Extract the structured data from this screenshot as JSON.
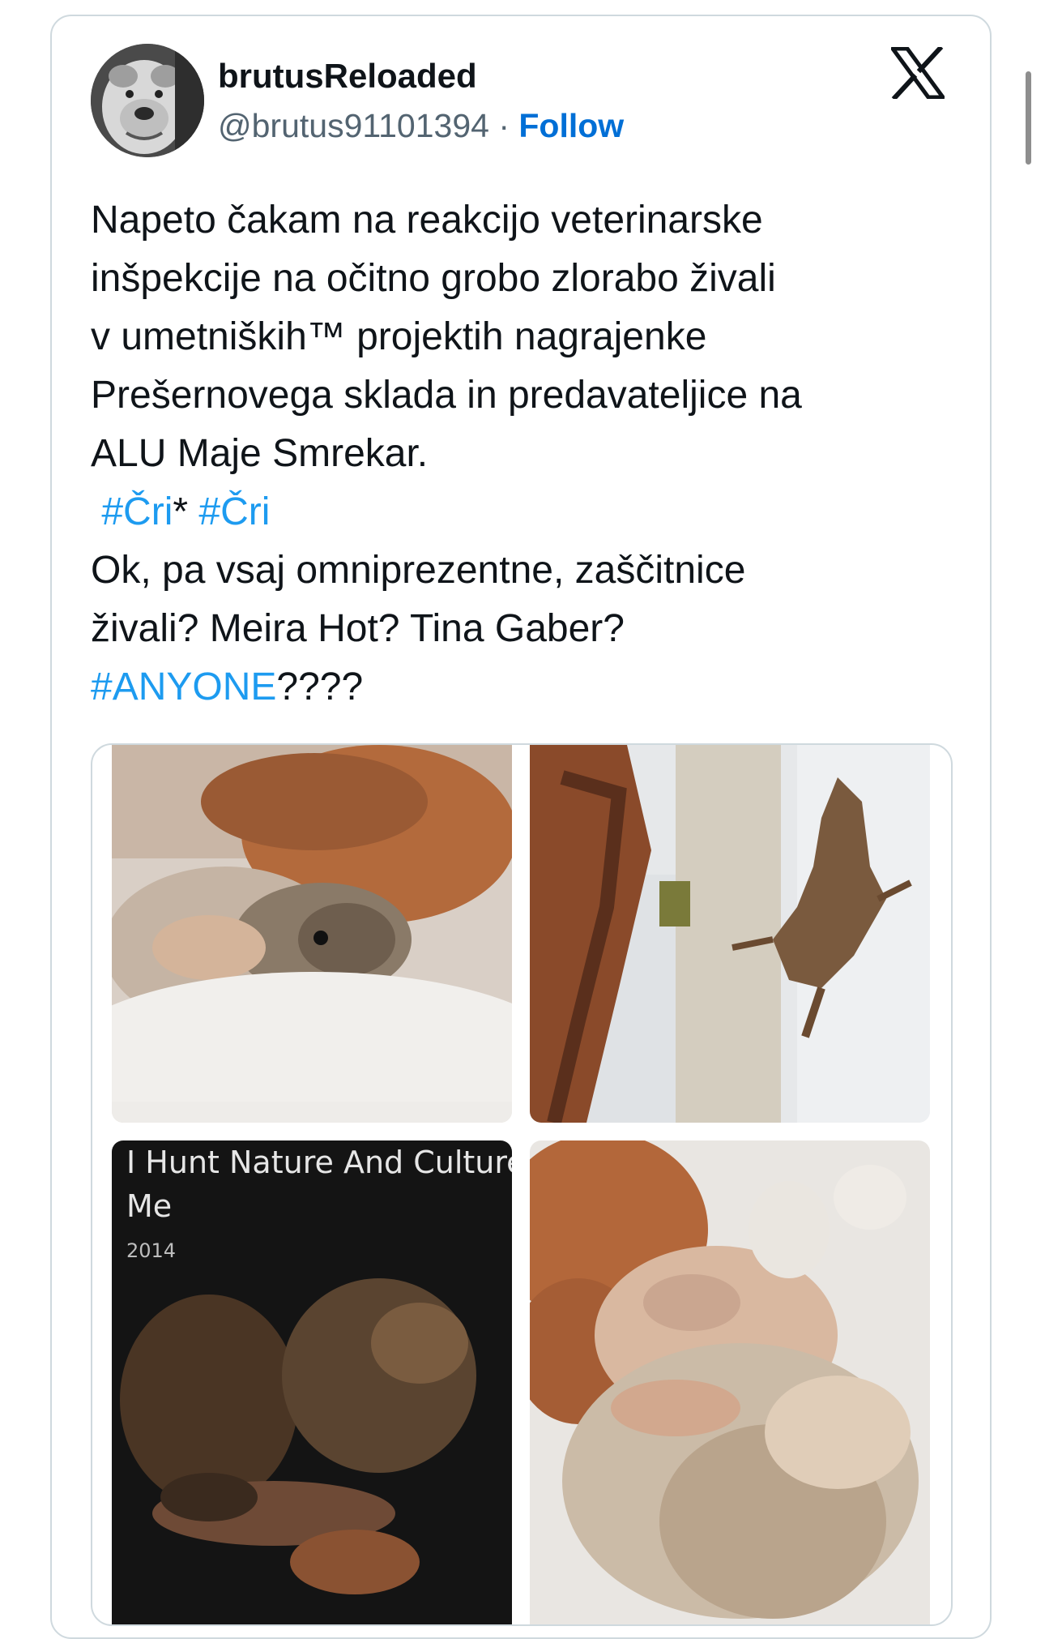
{
  "user": {
    "display_name": "brutusReloaded",
    "handle": "@brutus91101394",
    "separator": " · ",
    "follow_label": "Follow"
  },
  "brand": {
    "logo_icon": "x-logo-icon"
  },
  "tweet": {
    "lines": [
      "Napeto čakam na reakcijo veterinarske",
      "inšpekcije na očitno grobo zlorabo živali",
      "v umetniških™ projektih nagrajenke",
      "Prešernovega sklada in predavateljice na",
      "ALU Maje Smrekar."
    ],
    "hashtag_1": "#Čri",
    "hashtag_sep": "* ",
    "hashtag_2": "#Čri",
    "lines_2": [
      "Ok, pa vsaj omniprezentne,  zaščitnice",
      "živali? Meira Hot? Tina Gaber?"
    ],
    "hashtag_3": "#ANYONE",
    "hashtag_3_suffix": "????"
  },
  "media": {
    "photo_3_title_line1": "I Hunt Nature And Culture f",
    "photo_3_title_line2": "Me",
    "photo_3_year": "2014"
  },
  "colors": {
    "link": "#1d9bf0",
    "follow": "#006fd6",
    "muted": "#536471",
    "border": "#cfd9de"
  }
}
